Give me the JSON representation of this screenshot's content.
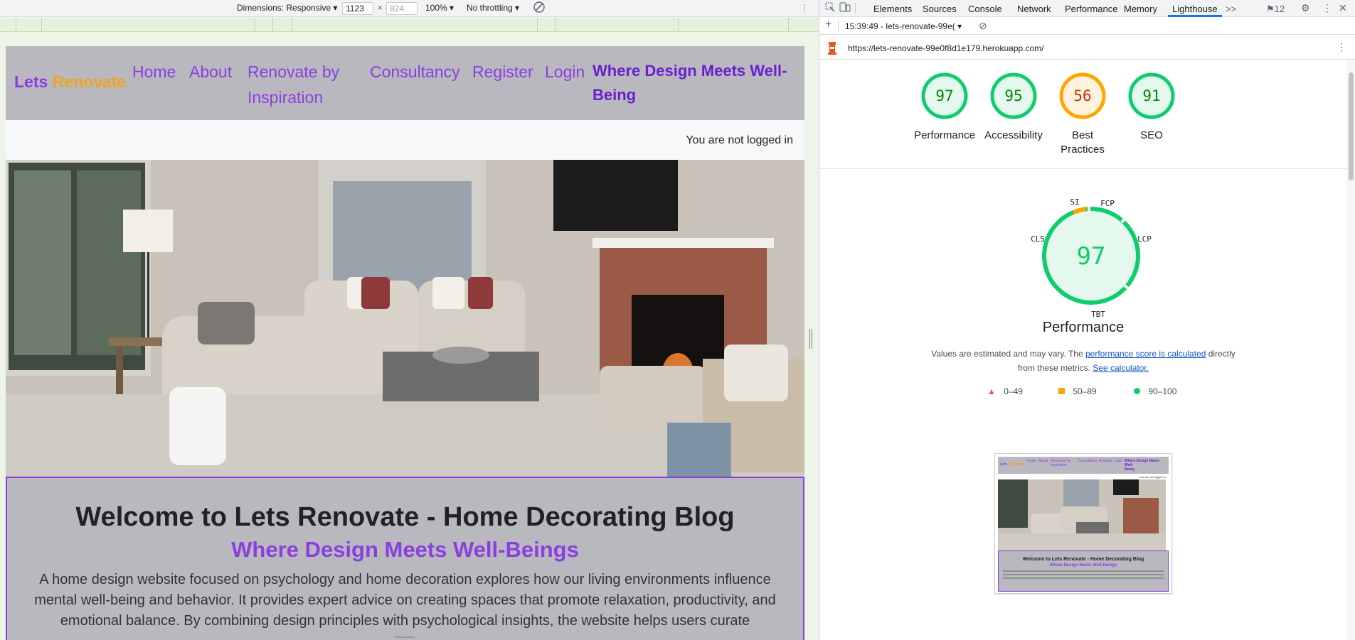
{
  "device_toolbar": {
    "dimensions_label": "Dimensions: Responsive",
    "width": "1123",
    "height": "824",
    "zoom": "100%",
    "throttling": "No throttling"
  },
  "site": {
    "brand_part1": "Lets",
    "brand_part2": "Renovate",
    "nav": {
      "home": "Home",
      "about": "About",
      "renovate_line1": "Renovate by",
      "renovate_line2": "Inspiration",
      "consultancy": "Consultancy",
      "register": "Register",
      "login": "Login"
    },
    "tagline_line1": "Where Design Meets Well-",
    "tagline_line2": "Being",
    "login_status": "You are not logged in",
    "welcome_title": "Welcome to Lets Renovate - Home Decorating Blog",
    "welcome_subtitle": "Where Design Meets Well-Beings",
    "welcome_text": "A home design website focused on psychology and home decoration explores how our living environments influence mental well-being and behavior. It provides expert advice on creating spaces that promote relaxation, productivity, and emotional balance. By combining design principles with psychological insights, the website helps users curate"
  },
  "devtools": {
    "tabs": [
      "Elements",
      "Sources",
      "Console",
      "Network",
      "Performance",
      "Memory",
      "Lighthouse"
    ],
    "active_tab": "Lighthouse",
    "more_tabs": ">>",
    "issues_count": "12",
    "run_label": "15:39:49 - lets-renovate-99e(",
    "url": "https://lets-renovate-99e0f8d1e179.herokuapp.com/",
    "add": "+"
  },
  "lighthouse": {
    "scores": [
      {
        "label_line1": "Performance",
        "label_line2": "",
        "value": "97",
        "level": "pass"
      },
      {
        "label_line1": "Accessibility",
        "label_line2": "",
        "value": "95",
        "level": "pass"
      },
      {
        "label_line1": "Best",
        "label_line2": "Practices",
        "value": "56",
        "level": "average"
      },
      {
        "label_line1": "SEO",
        "label_line2": "",
        "value": "91",
        "level": "pass"
      }
    ],
    "main_score": "97",
    "main_title": "Performance",
    "metrics": {
      "si": "SI",
      "fcp": "FCP",
      "lcp": "LCP",
      "tbt": "TBT",
      "cls": "CLS"
    },
    "desc_prefix": "Values are estimated and may vary. The ",
    "desc_link": "performance score is calculated",
    "desc_middle": " directly from these metrics. ",
    "desc_link2": "See calculator.",
    "legend": {
      "fail": "0–49",
      "average": "50–89",
      "pass": "90–100"
    },
    "colors": {
      "pass": "#0cce6b",
      "pass_text": "#008800",
      "average": "#ffa400",
      "average_text": "#c33300",
      "fail": "#ff4e42"
    }
  },
  "thumbnail": {
    "title": "Welcome to Lets Renovate - Home Decorating Blog",
    "subtitle": "Where Design Meets Well-Beings",
    "status": "You are not logged in",
    "brand_part1": "Lets",
    "brand_part2": "Renovate",
    "nav_home": "Home",
    "nav_about": "About",
    "nav_renovate_line1": "Renovate by",
    "nav_renovate_line2": "Inspiration",
    "nav_consultancy": "Consultancy",
    "nav_register": "Register",
    "nav_login": "Login",
    "tagline_line1": "Where Design Meets Well-",
    "tagline_line2": "Being"
  }
}
